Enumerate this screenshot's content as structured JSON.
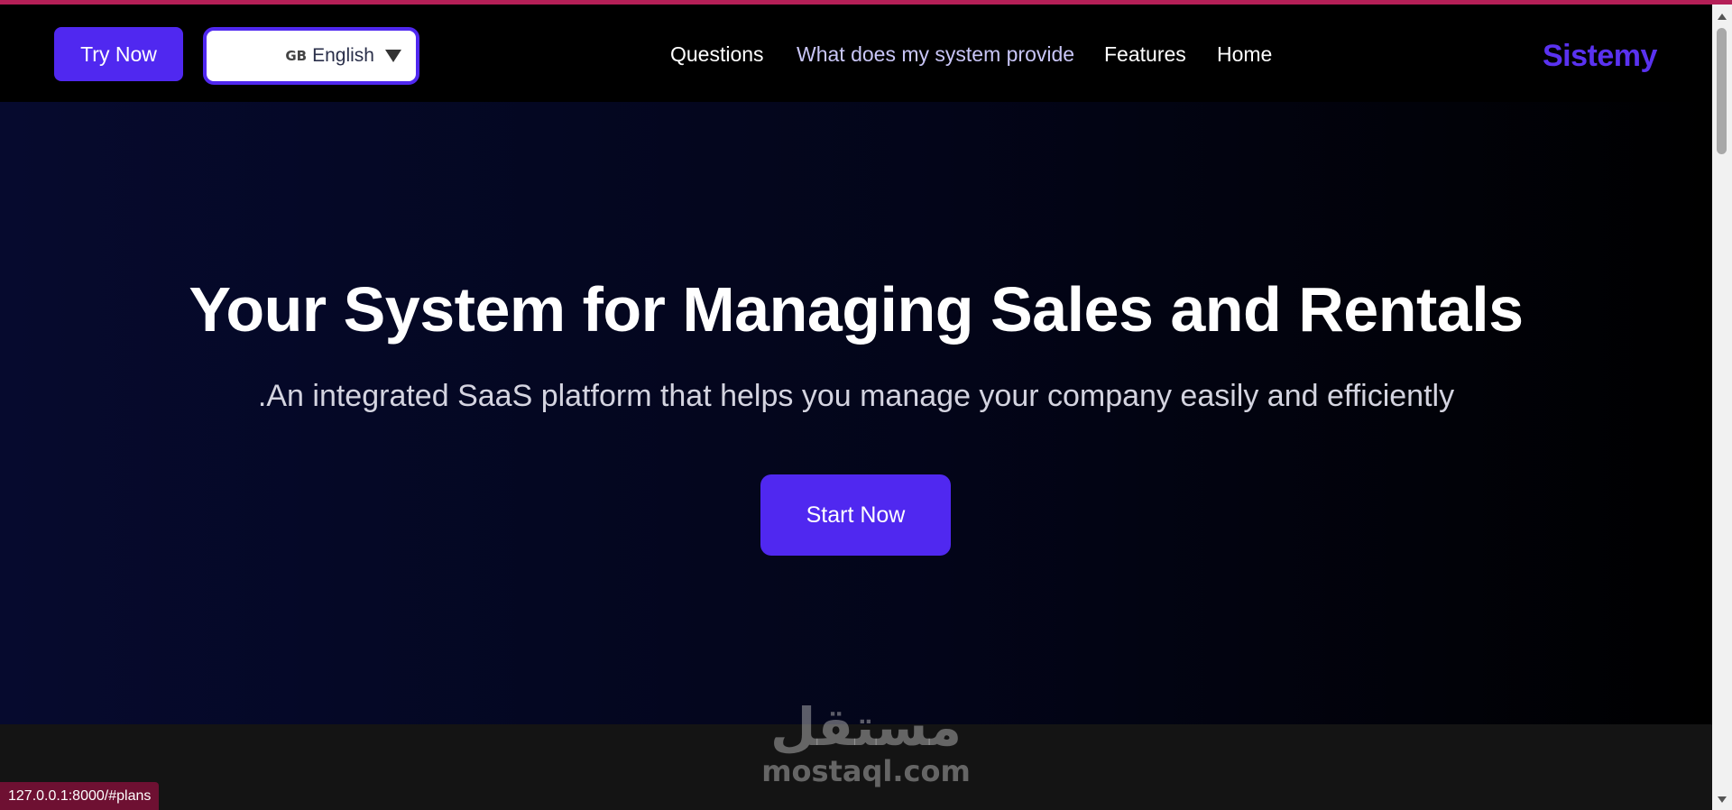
{
  "navbar": {
    "try_label": "Try Now",
    "language": {
      "flag": "GB",
      "selected": "English"
    },
    "links": [
      "Questions",
      "What does my system provide",
      "Features",
      "Home"
    ],
    "brand": "Sistemy"
  },
  "hero": {
    "title": "Your System for Managing Sales and Rentals",
    "subtitle": ".An integrated SaaS platform that helps you manage your company easily and efficiently",
    "cta_label": "Start Now"
  },
  "watermark": {
    "arabic": "مستقل",
    "latin": "mostaql.com"
  },
  "status_bar": {
    "url": "127.0.0.1:8000/#plans"
  },
  "colors": {
    "accent": "#5028f0",
    "brand": "#5a32f0",
    "top_accent": "#b41f57",
    "status_bg": "#6e1032"
  },
  "icons": {
    "language_caret": "chevron-down-icon"
  }
}
